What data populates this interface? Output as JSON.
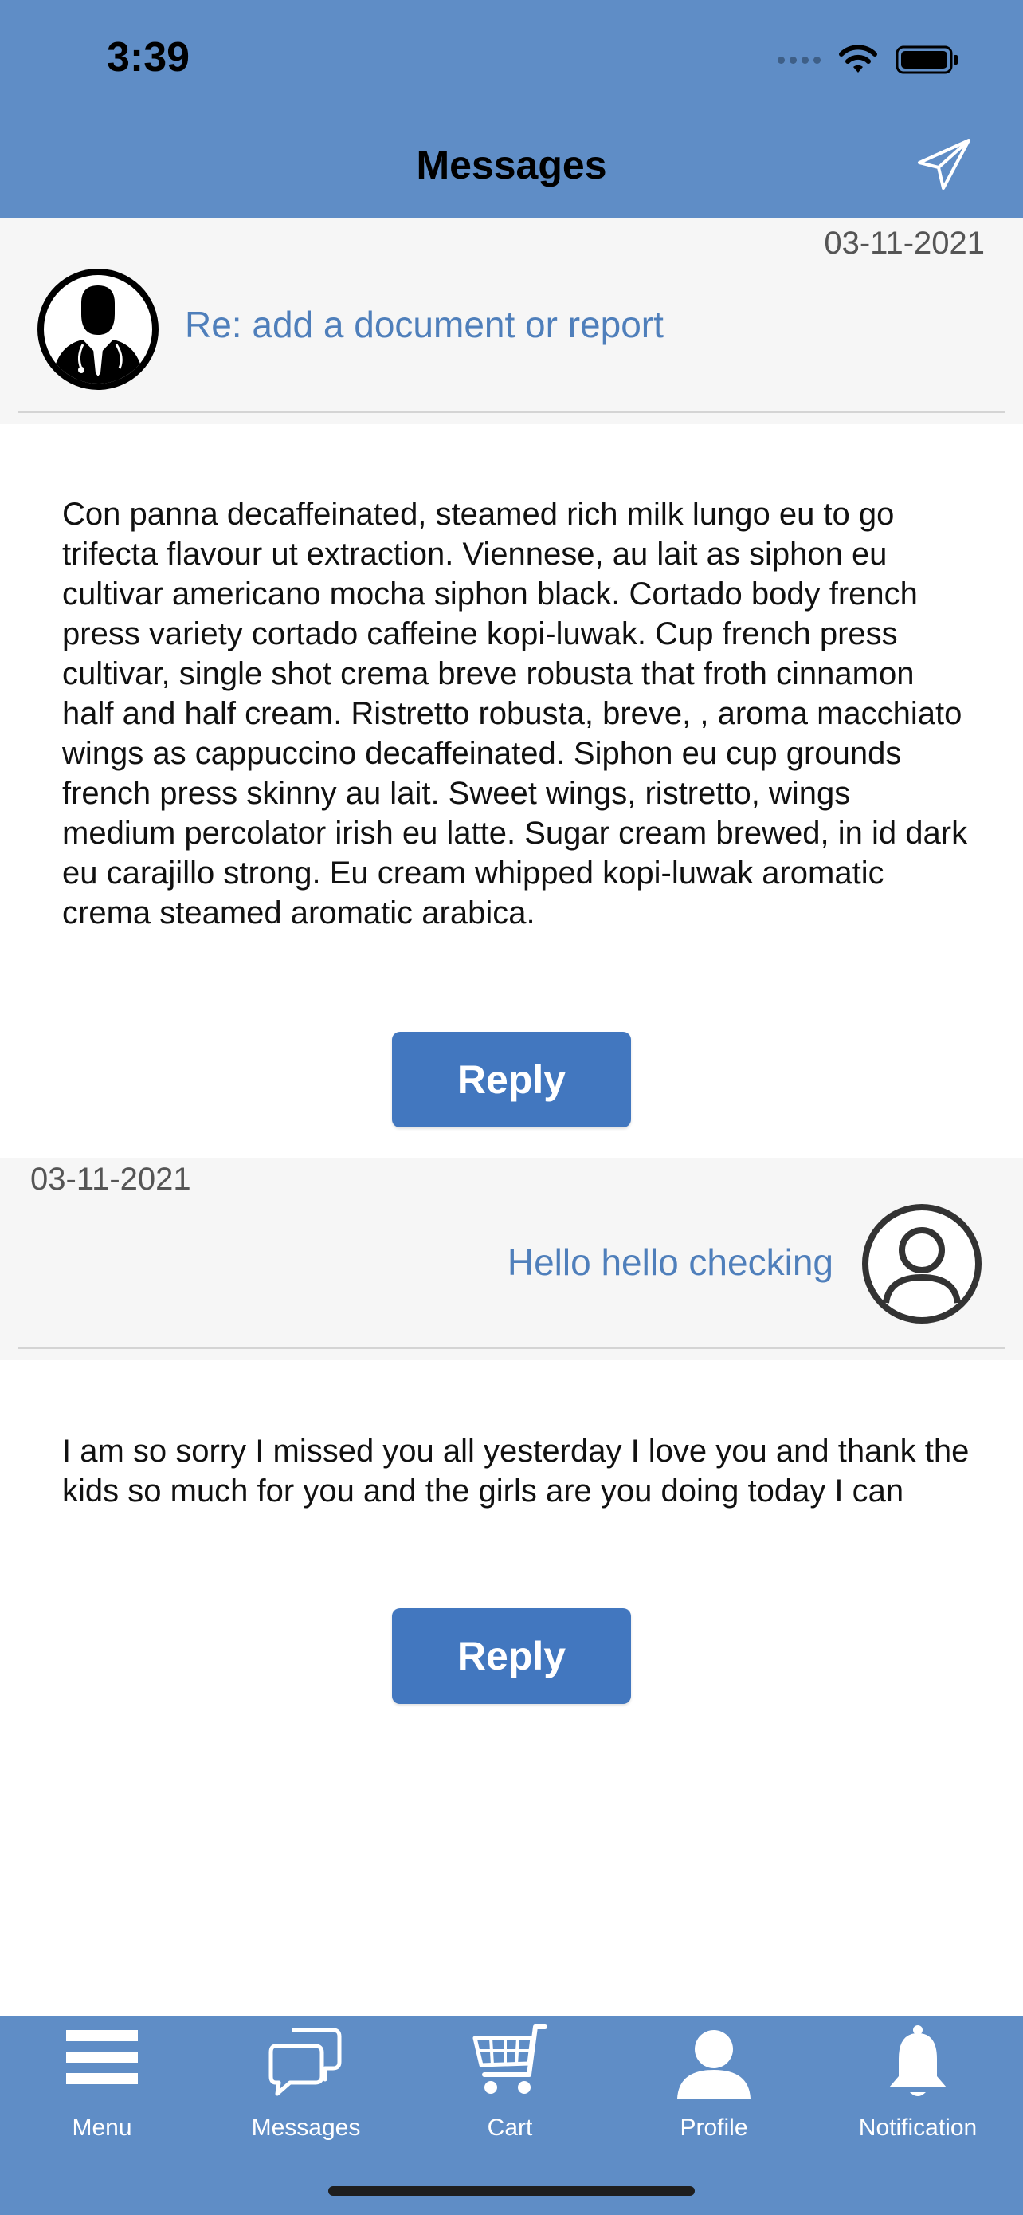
{
  "status_bar": {
    "time": "3:39"
  },
  "header": {
    "title": "Messages"
  },
  "messages": [
    {
      "date": "03-11-2021",
      "subject": "Re: add a document or report",
      "body": "Con panna decaffeinated, steamed rich milk lungo eu to go trifecta flavour ut extraction. Viennese, au lait as siphon eu cultivar americano mocha siphon black. Cortado body french press variety cortado caffeine kopi-luwak. Cup french press cultivar, single shot crema breve robusta that froth cinnamon half and half cream. Ristretto robusta, breve, , aroma macchiato wings as cappuccino decaffeinated. Siphon eu cup grounds french press skinny au lait. Sweet wings, ristretto, wings medium percolator irish eu latte. Sugar cream brewed, in id dark eu carajillo strong. Eu cream whipped kopi-luwak aromatic crema steamed aromatic arabica.",
      "reply_label": "Reply",
      "avatar_icon": "doctor-avatar-icon"
    },
    {
      "date": "03-11-2021",
      "subject": "Hello hello checking",
      "body": "I am so sorry I missed you all yesterday I love you and thank the kids so much for you and the girls are you doing today I can",
      "reply_label": "Reply",
      "avatar_icon": "user-avatar-icon"
    }
  ],
  "tabbar": {
    "items": [
      {
        "label": "Menu",
        "icon": "menu-icon"
      },
      {
        "label": "Messages",
        "icon": "chat-icon"
      },
      {
        "label": "Cart",
        "icon": "cart-icon"
      },
      {
        "label": "Profile",
        "icon": "profile-icon"
      },
      {
        "label": "Notification",
        "icon": "bell-icon"
      }
    ]
  },
  "colors": {
    "header_bg": "#5f8dc6",
    "accent_text": "#4f7fbb",
    "button_bg": "#4277bf",
    "message_header_bg": "#f6f6f6"
  }
}
